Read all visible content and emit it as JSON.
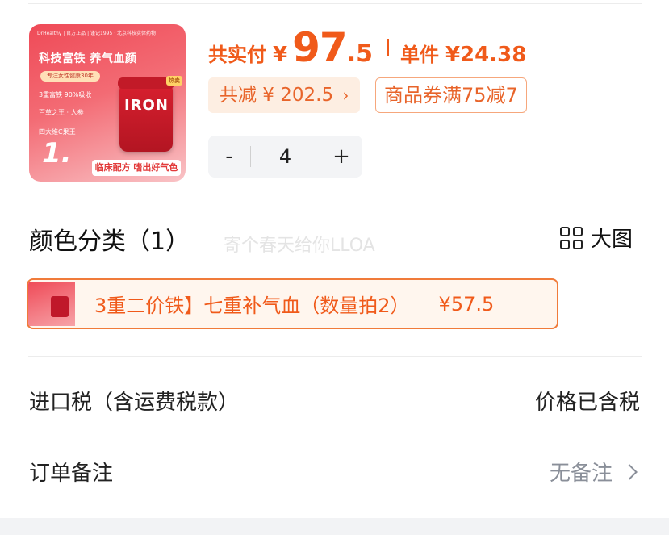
{
  "product": {
    "image": {
      "brand_row": "DrHealthy | 官方正品 | 谨记1995 · 北京科技实体药物",
      "headline": "科技富铁 养气血颜",
      "pill": "专注女性健康30年",
      "features": [
        "3重富铁 90%吸收",
        "百草之王 · 人参",
        "四大维C果王"
      ],
      "big_number": "1.",
      "jar_label": "IRON",
      "hot_badge": "热卖",
      "banner": "临床配方 嗜出好气色"
    },
    "price": {
      "total_label": "共实付",
      "currency": "¥",
      "total_int": "97",
      "total_dec": ".5",
      "unit_label": "单件",
      "unit_price": "¥24.38",
      "accent_color": "#f05a1a"
    },
    "discount_chip": {
      "text": "共减 ¥ 202.5",
      "arrow": "›"
    },
    "coupon_chip": {
      "text": "商品券满75减7"
    },
    "quantity": {
      "minus": "-",
      "value": "4",
      "plus": "+"
    }
  },
  "variant_section": {
    "title": "颜色分类（1）",
    "view_toggle_label": "大图",
    "view_toggle_icon": "grid-icon",
    "watermark": "寄个春天给你LLOA",
    "selected_variant": {
      "name": "3重二价铁】七重补气血（数量拍2）",
      "price": "¥57.5",
      "border_color": "#f07b3a"
    }
  },
  "rows": {
    "tax": {
      "label": "进口税（含运费税款）",
      "value": "价格已含税"
    },
    "note": {
      "label": "订单备注",
      "value": "无备注",
      "icon": "chevron-right-icon"
    }
  }
}
